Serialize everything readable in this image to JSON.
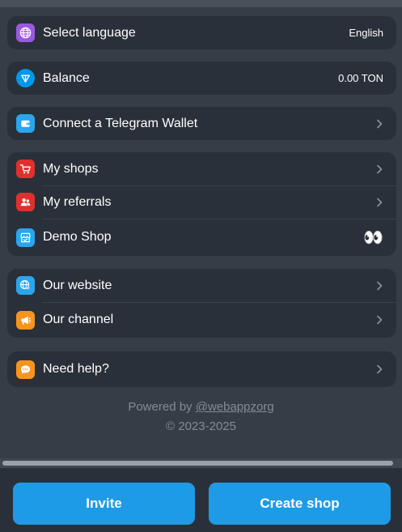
{
  "settings": {
    "language_label": "Select language",
    "language_value": "English",
    "balance_label": "Balance",
    "balance_value": "0.00 TON",
    "connect_wallet_label": "Connect a Telegram Wallet"
  },
  "menu": {
    "my_shops": "My shops",
    "my_referrals": "My referrals",
    "demo_shop": "Demo Shop",
    "demo_shop_badge": "👀",
    "our_website": "Our website",
    "our_channel": "Our channel",
    "need_help": "Need help?"
  },
  "footer": {
    "powered_prefix": "Powered by ",
    "powered_link": "@webappzorg",
    "copyright": "© 2023-2025"
  },
  "actions": {
    "invite": "Invite",
    "create_shop": "Create shop"
  },
  "icons": {
    "globe": "globe-icon",
    "ton": "ton-diamond-icon",
    "wallet": "wallet-icon",
    "cart": "cart-icon",
    "users": "users-icon",
    "shop": "shop-icon",
    "web": "web-cursor-icon",
    "megaphone": "megaphone-icon",
    "chat": "chat-icon",
    "chevron": "chevron-right-icon"
  },
  "colors": {
    "accent": "#1e9be6",
    "purple": "#9b59e0",
    "ton_blue": "#0098ea",
    "red": "#e0302e",
    "orange": "#f7941d"
  }
}
